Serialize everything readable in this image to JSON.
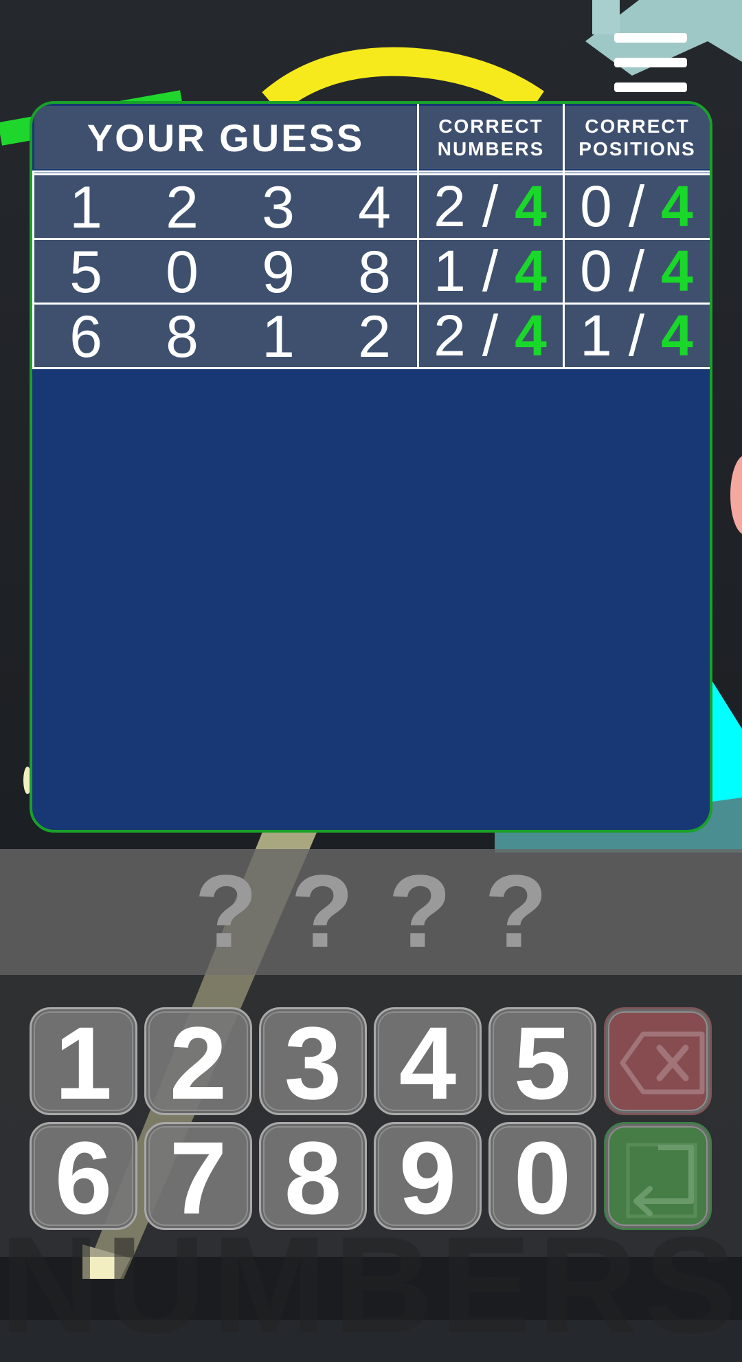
{
  "menu": {
    "icon": "hamburger-menu-icon"
  },
  "board": {
    "header": {
      "guess": "YOUR GUESS",
      "numbers": "CORRECT\nNUMBERS",
      "positions": "CORRECT\nPOSITIONS"
    },
    "rows": [
      {
        "digits": [
          "1",
          "2",
          "3",
          "4"
        ],
        "numbers": {
          "correct": "2",
          "sep": "/",
          "total": "4"
        },
        "positions": {
          "correct": "0",
          "sep": "/",
          "total": "4"
        }
      },
      {
        "digits": [
          "5",
          "0",
          "9",
          "8"
        ],
        "numbers": {
          "correct": "1",
          "sep": "/",
          "total": "4"
        },
        "positions": {
          "correct": "0",
          "sep": "/",
          "total": "4"
        }
      },
      {
        "digits": [
          "6",
          "8",
          "1",
          "2"
        ],
        "numbers": {
          "correct": "2",
          "sep": "/",
          "total": "4"
        },
        "positions": {
          "correct": "1",
          "sep": "/",
          "total": "4"
        }
      }
    ],
    "colors": {
      "border": "#1aa12a",
      "panel": "#173874",
      "cell": "#3f506f",
      "total": "#19d82a"
    }
  },
  "entry": {
    "slots": [
      "?",
      "?",
      "?",
      "?"
    ]
  },
  "keypad": {
    "row1": [
      "1",
      "2",
      "3",
      "4",
      "5"
    ],
    "row2": [
      "6",
      "7",
      "8",
      "9",
      "0"
    ],
    "delete_icon": "backspace-icon",
    "enter_icon": "enter-return-icon",
    "colors": {
      "delete": "#8b4e52",
      "enter": "#488248"
    }
  },
  "watermark": "NUMBERS"
}
